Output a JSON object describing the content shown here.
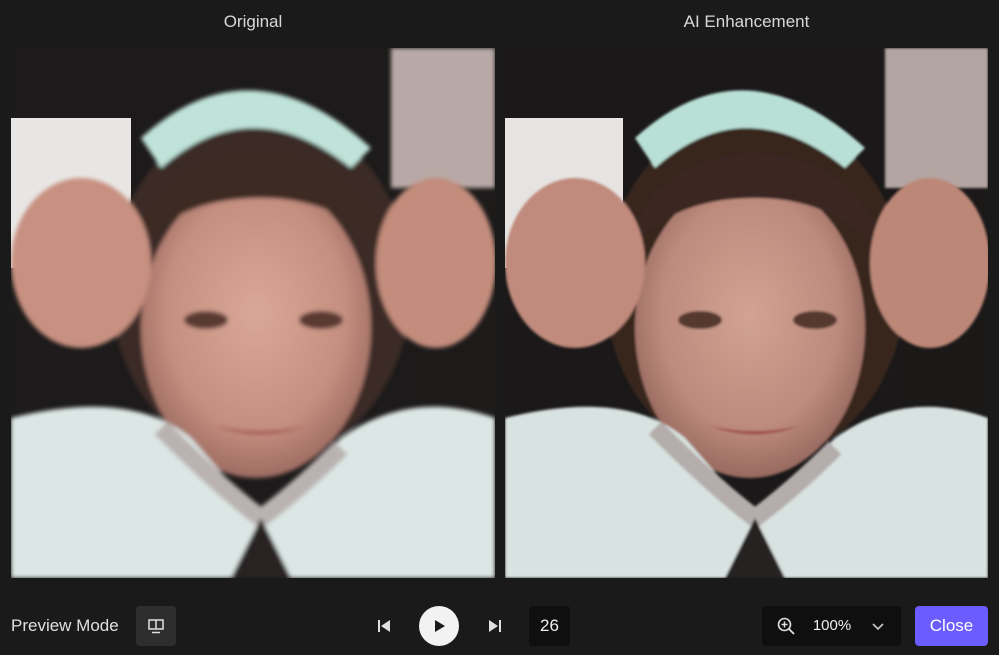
{
  "panels": {
    "left_title": "Original",
    "right_title": "AI Enhancement"
  },
  "toolbar": {
    "preview_mode_label": "Preview Mode",
    "frame_number": "26",
    "zoom_value": "100%",
    "close_label": "Close"
  },
  "icons": {
    "preview_mode": "monitor-icon",
    "previous": "skip-previous-icon",
    "play": "play-icon",
    "next": "skip-next-icon",
    "zoom": "zoom-in-icon",
    "dropdown": "chevron-down-icon"
  },
  "colors": {
    "accent": "#6a5cff",
    "background": "#1a1a1a",
    "field_background": "#0f0f0f"
  }
}
